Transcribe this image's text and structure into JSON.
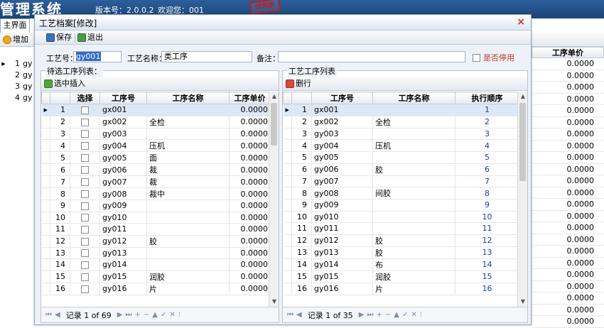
{
  "app": {
    "title": "管理系统",
    "version": "版本号：2.0.0.2",
    "welcome": "欢迎您：001",
    "stamp": "试用版",
    "main_tab": "主界面",
    "add_label": "增加",
    "price_header": "工序单价",
    "bg_rows": [
      {
        "num": "1",
        "code": "gy"
      },
      {
        "num": "2",
        "code": "gy"
      },
      {
        "num": "3",
        "code": "gy"
      },
      {
        "num": "4",
        "code": "gy"
      }
    ],
    "bg_prices": [
      "0.0000",
      "0.0000",
      "0.0000",
      "0.0000",
      "0.0000",
      "0.0000",
      "0.0000",
      "0.0000",
      "0.0000",
      "0.0000",
      "0.0000",
      "0.0000",
      "0.0000",
      "0.0000",
      "0.0000",
      "0.0000",
      "0.0000",
      "0.0000",
      "0.0000",
      "0.0000",
      "0.0000",
      "0.0000",
      "0.0000"
    ]
  },
  "dialog": {
    "title": "工艺档案[修改]",
    "close": "×",
    "toolbar": {
      "save": "保存",
      "exit": "退出"
    },
    "form": {
      "code_label": "工艺号：",
      "code_value": "gy001",
      "name_label": "工艺名称：",
      "name_value": "类工序",
      "remark_label": "备注：",
      "remark_value": "",
      "disabled_label": "是否停用"
    },
    "left_panel": {
      "title": "待选工序列表：",
      "insert_button": "选中插入",
      "headers": [
        "选择",
        "工序号",
        "工序名称",
        "工序单价"
      ],
      "rows": [
        {
          "num": "1",
          "code": "gx001",
          "name": "",
          "price": "0.0000"
        },
        {
          "num": "2",
          "code": "gx002",
          "name": "全检",
          "price": "0.0000"
        },
        {
          "num": "3",
          "code": "gy003",
          "name": "",
          "price": "0.0000"
        },
        {
          "num": "4",
          "code": "gy004",
          "name": "压机",
          "price": "0.0000"
        },
        {
          "num": "5",
          "code": "gy005",
          "name": "面",
          "price": "0.0000"
        },
        {
          "num": "6",
          "code": "gy006",
          "name": "裁",
          "price": "0.0000"
        },
        {
          "num": "7",
          "code": "gy007",
          "name": "裁",
          "price": "0.0000"
        },
        {
          "num": "8",
          "code": "gy008",
          "name": "裁中",
          "price": "0.0000"
        },
        {
          "num": "9",
          "code": "gy009",
          "name": "",
          "price": "0.0000"
        },
        {
          "num": "10",
          "code": "gy010",
          "name": "",
          "price": "0.0000"
        },
        {
          "num": "11",
          "code": "gy011",
          "name": "",
          "price": "0.0000"
        },
        {
          "num": "12",
          "code": "gy012",
          "name": "胶",
          "price": "0.0000"
        },
        {
          "num": "13",
          "code": "gy013",
          "name": "",
          "price": "0.0000"
        },
        {
          "num": "14",
          "code": "gy014",
          "name": "",
          "price": "0.0000"
        },
        {
          "num": "15",
          "code": "gy015",
          "name": "润胶",
          "price": "0.0000"
        },
        {
          "num": "16",
          "code": "gy016",
          "name": "片",
          "price": "0.0000"
        }
      ],
      "pager": "记录 1 of 69"
    },
    "right_panel": {
      "title": "工艺工序列表",
      "delete_button": "删行",
      "headers": [
        "工序号",
        "工序名称",
        "执行顺序"
      ],
      "rows": [
        {
          "num": "1",
          "code": "gx001",
          "name": "",
          "order": "1"
        },
        {
          "num": "2",
          "code": "gx002",
          "name": "全检",
          "order": "2"
        },
        {
          "num": "3",
          "code": "gy003",
          "name": "",
          "order": "3"
        },
        {
          "num": "4",
          "code": "gy004",
          "name": "压机",
          "order": "4"
        },
        {
          "num": "5",
          "code": "gy005",
          "name": "",
          "order": "5"
        },
        {
          "num": "6",
          "code": "gy006",
          "name": "胶",
          "order": "6"
        },
        {
          "num": "7",
          "code": "gy007",
          "name": "",
          "order": "7"
        },
        {
          "num": "8",
          "code": "gy008",
          "name": "间胶",
          "order": "8"
        },
        {
          "num": "9",
          "code": "gy009",
          "name": "",
          "order": "9"
        },
        {
          "num": "10",
          "code": "gy010",
          "name": "",
          "order": "10"
        },
        {
          "num": "11",
          "code": "gy011",
          "name": "",
          "order": "11"
        },
        {
          "num": "12",
          "code": "gy012",
          "name": "胶",
          "order": "12"
        },
        {
          "num": "13",
          "code": "gy013",
          "name": "胶",
          "order": "13"
        },
        {
          "num": "14",
          "code": "gy014",
          "name": "布",
          "order": "14"
        },
        {
          "num": "15",
          "code": "gy015",
          "name": "润胶",
          "order": "15"
        },
        {
          "num": "16",
          "code": "gy016",
          "name": "片",
          "order": "16"
        }
      ],
      "pager": "记录 1 of 35"
    },
    "pager_controls": {
      "first": "⏮",
      "prev": "◀",
      "next": "▶",
      "last": "⏭",
      "add": "+",
      "remove": "−",
      "up": "▲",
      "ok": "✓",
      "cancel": "✕",
      "more": "⁝"
    }
  }
}
